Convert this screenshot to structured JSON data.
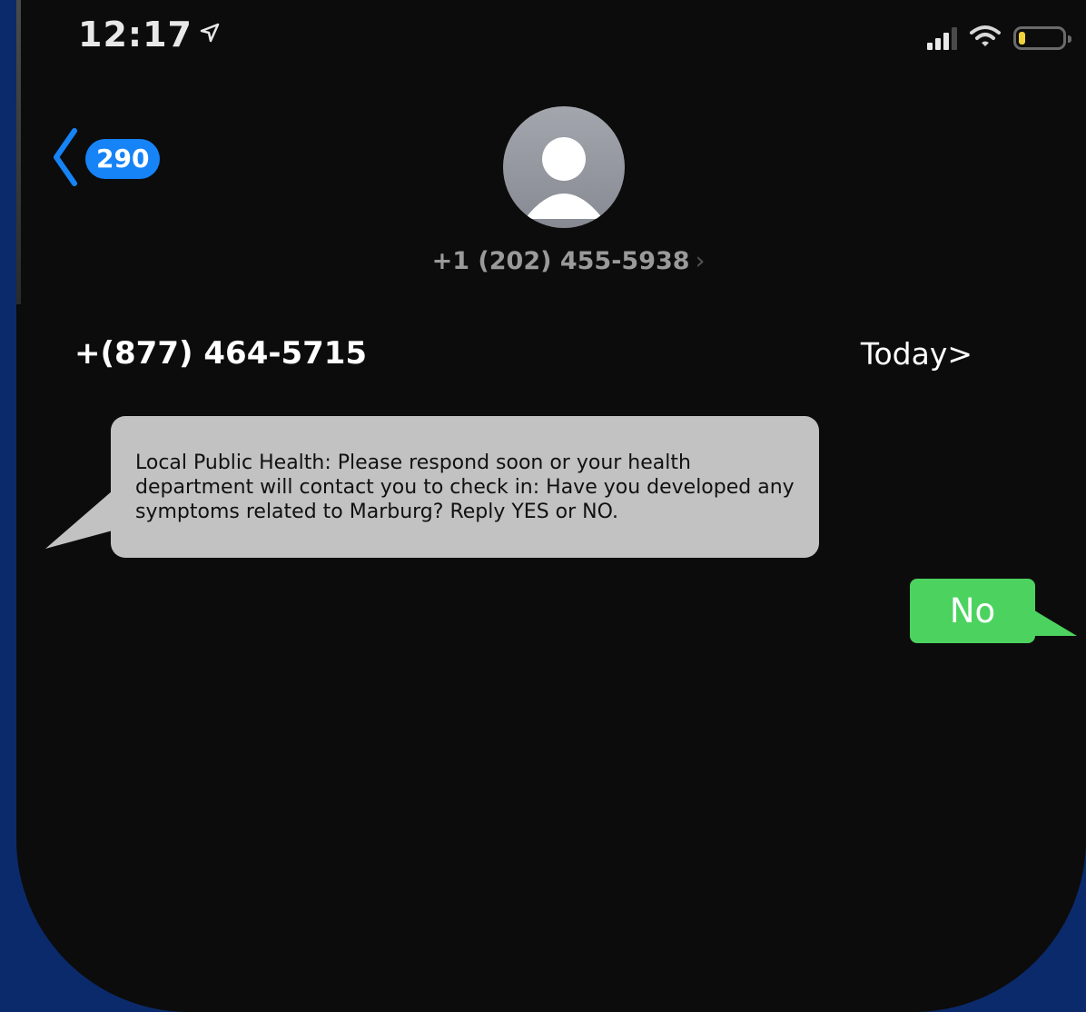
{
  "status_bar": {
    "time": "12:17",
    "location_icon": "location-arrow-icon",
    "signal_icon": "cellular-signal-icon",
    "wifi_icon": "wifi-icon",
    "battery_icon": "battery-icon",
    "battery_level": 0.15
  },
  "header": {
    "back_icon": "chevron-left-icon",
    "unread_count": "290",
    "avatar_icon": "person-silhouette-icon",
    "contact_number": "+1 (202) 455-5938",
    "contact_chevron": "›"
  },
  "conversation": {
    "sender": "+(877) 464-5715",
    "date_link": "Today>",
    "messages": [
      {
        "direction": "incoming",
        "text": "Local Public Health: Please respond soon or your health department will contact you to check in: Have you developed any symptoms related to Marburg? Reply YES or NO."
      },
      {
        "direction": "outgoing",
        "text": "No"
      }
    ]
  },
  "colors": {
    "background": "#0b2a6b",
    "screen": "#0c0c0c",
    "incoming_bubble": "#c2c2c2",
    "outgoing_bubble": "#4cd35f",
    "badge": "#1683f7"
  }
}
